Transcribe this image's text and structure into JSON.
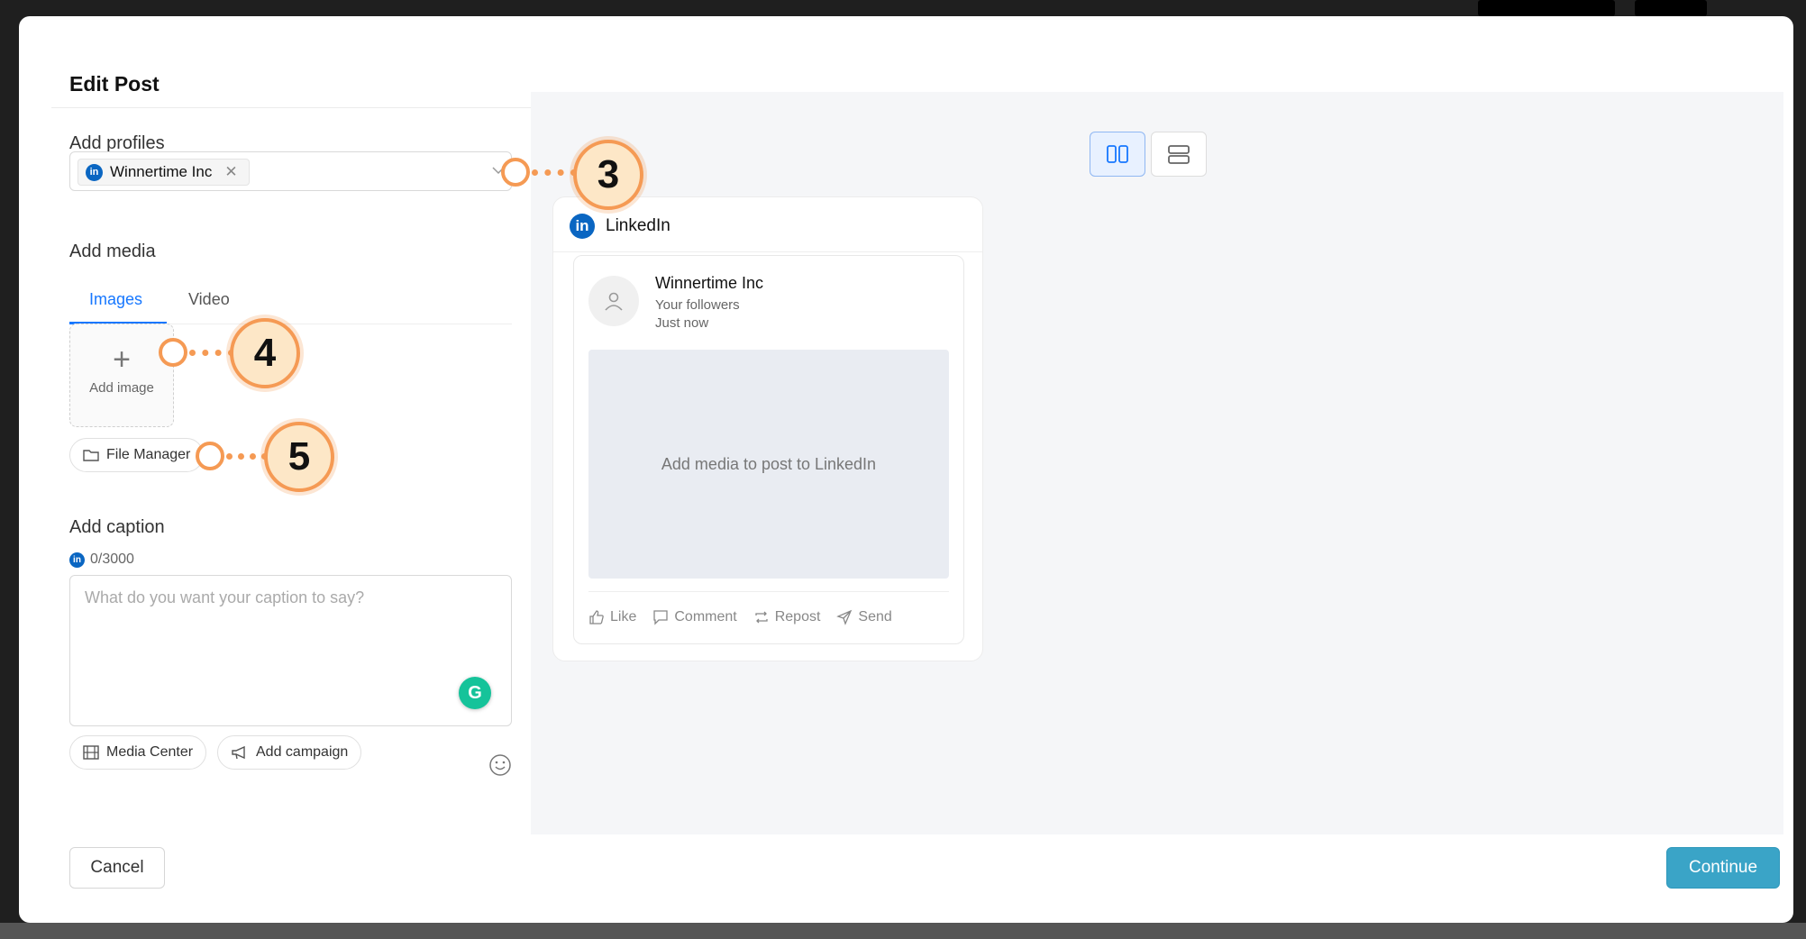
{
  "modal": {
    "title": "Edit Post"
  },
  "profiles": {
    "label": "Add profiles",
    "selected": [
      {
        "network_badge": "in",
        "name": "Winnertime Inc"
      }
    ]
  },
  "media": {
    "label": "Add media",
    "tabs": [
      {
        "label": "Images",
        "active": true
      },
      {
        "label": "Video",
        "active": false
      }
    ],
    "add_image_label": "Add image",
    "file_manager_label": "File Manager"
  },
  "caption": {
    "label": "Add caption",
    "counter": "0/3000",
    "placeholder": "What do you want your caption to say?",
    "value": ""
  },
  "caption_tools": {
    "media_center": "Media Center",
    "add_campaign": "Add campaign"
  },
  "preview": {
    "network": "LinkedIn",
    "author": "Winnertime Inc",
    "audience": "Your followers",
    "time": "Just now",
    "media_placeholder": "Add media to post to LinkedIn",
    "actions": [
      "Like",
      "Comment",
      "Repost",
      "Send"
    ]
  },
  "footer": {
    "cancel": "Cancel",
    "continue": "Continue"
  },
  "callouts": [
    "3",
    "4",
    "5"
  ],
  "colors": {
    "accent": "#1677ff",
    "continue": "#3aa4c7",
    "linkedin": "#0a66c2",
    "callout": "#f59a54",
    "grammarly": "#15c39a"
  }
}
